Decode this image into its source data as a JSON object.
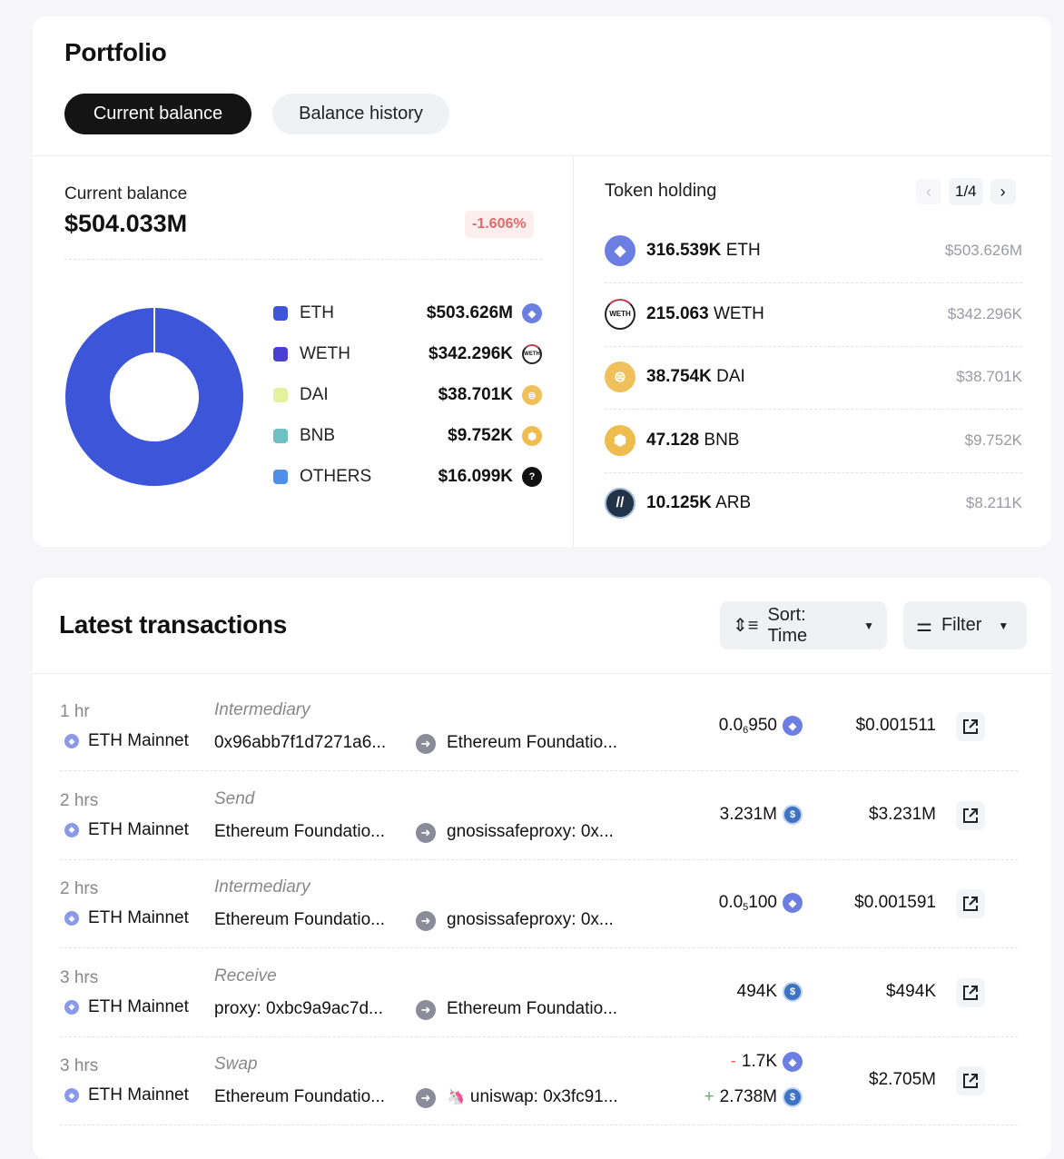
{
  "portfolio": {
    "title": "Portfolio",
    "tabs": [
      {
        "label": "Current balance",
        "active": true
      },
      {
        "label": "Balance history",
        "active": false
      }
    ],
    "balance_label": "Current balance",
    "balance_value": "$504.033M",
    "change_badge": "-1.606%",
    "legend": [
      {
        "name": "ETH",
        "value": "$503.626M",
        "color": "#3d55d8",
        "icon": "eth-icon"
      },
      {
        "name": "WETH",
        "value": "$342.296K",
        "color": "#4a40d0",
        "icon": "weth-icon"
      },
      {
        "name": "DAI",
        "value": "$38.701K",
        "color": "#e4f2a0",
        "icon": "dai-icon"
      },
      {
        "name": "BNB",
        "value": "$9.752K",
        "color": "#6ec1c0",
        "icon": "bnb-icon"
      },
      {
        "name": "OTHERS",
        "value": "$16.099K",
        "color": "#4f8fe6",
        "icon": "question-icon"
      }
    ]
  },
  "chart_data": {
    "type": "pie",
    "title": "Current balance",
    "categories": [
      "ETH",
      "WETH",
      "DAI",
      "BNB",
      "OTHERS"
    ],
    "values": [
      503626000,
      342296,
      38701,
      9752,
      16099
    ],
    "colors": [
      "#3d55d8",
      "#4a40d0",
      "#e4f2a0",
      "#6ec1c0",
      "#4f8fe6"
    ],
    "donut": true
  },
  "token_holding": {
    "title": "Token holding",
    "page": "1/4",
    "prev_icon": "chevron-left-icon",
    "next_icon": "chevron-right-icon",
    "items": [
      {
        "amount": "316.539K",
        "symbol": "ETH",
        "usd": "$503.626M",
        "icon": "eth-icon"
      },
      {
        "amount": "215.063",
        "symbol": "WETH",
        "usd": "$342.296K",
        "icon": "weth-icon"
      },
      {
        "amount": "38.754K",
        "symbol": "DAI",
        "usd": "$38.701K",
        "icon": "dai-icon"
      },
      {
        "amount": "47.128",
        "symbol": "BNB",
        "usd": "$9.752K",
        "icon": "bnb-icon"
      },
      {
        "amount": "10.125K",
        "symbol": "ARB",
        "usd": "$8.211K",
        "icon": "arb-icon"
      }
    ]
  },
  "transactions": {
    "title": "Latest transactions",
    "sort_label": "Sort: Time",
    "filter_label": "Filter",
    "rows": [
      {
        "time": "1 hr",
        "network": "ETH Mainnet",
        "type": "Intermediary",
        "from": "0x96abb7f1d7271a6...",
        "to": "Ethereum Foundatio...",
        "amount_main": "0.0",
        "amount_sub": "6",
        "amount_tail": "950",
        "token": "eth",
        "usd": "$0.001511"
      },
      {
        "time": "2 hrs",
        "network": "ETH Mainnet",
        "type": "Send",
        "from": "Ethereum Foundatio...",
        "to": "gnosissafeproxy: 0x...",
        "amount_main": "3.231M",
        "amount_sub": "",
        "amount_tail": "",
        "token": "usdc",
        "usd": "$3.231M"
      },
      {
        "time": "2 hrs",
        "network": "ETH Mainnet",
        "type": "Intermediary",
        "from": "Ethereum Foundatio...",
        "to": "gnosissafeproxy: 0x...",
        "amount_main": "0.0",
        "amount_sub": "5",
        "amount_tail": "100",
        "token": "eth",
        "usd": "$0.001591"
      },
      {
        "time": "3 hrs",
        "network": "ETH Mainnet",
        "type": "Receive",
        "from": "proxy: 0xbc9a9ac7d...",
        "to": "Ethereum Foundatio...",
        "amount_main": "494K",
        "amount_sub": "",
        "amount_tail": "",
        "token": "usdc",
        "usd": "$494K"
      },
      {
        "time": "3 hrs",
        "network": "ETH Mainnet",
        "type": "Swap",
        "from": "Ethereum Foundatio...",
        "to": "uniswap: 0x3fc91...",
        "swap_out": "1.7K",
        "swap_out_sign": "-",
        "swap_in": "2.738M",
        "swap_in_sign": "+",
        "usd": "$2.705M"
      }
    ]
  }
}
